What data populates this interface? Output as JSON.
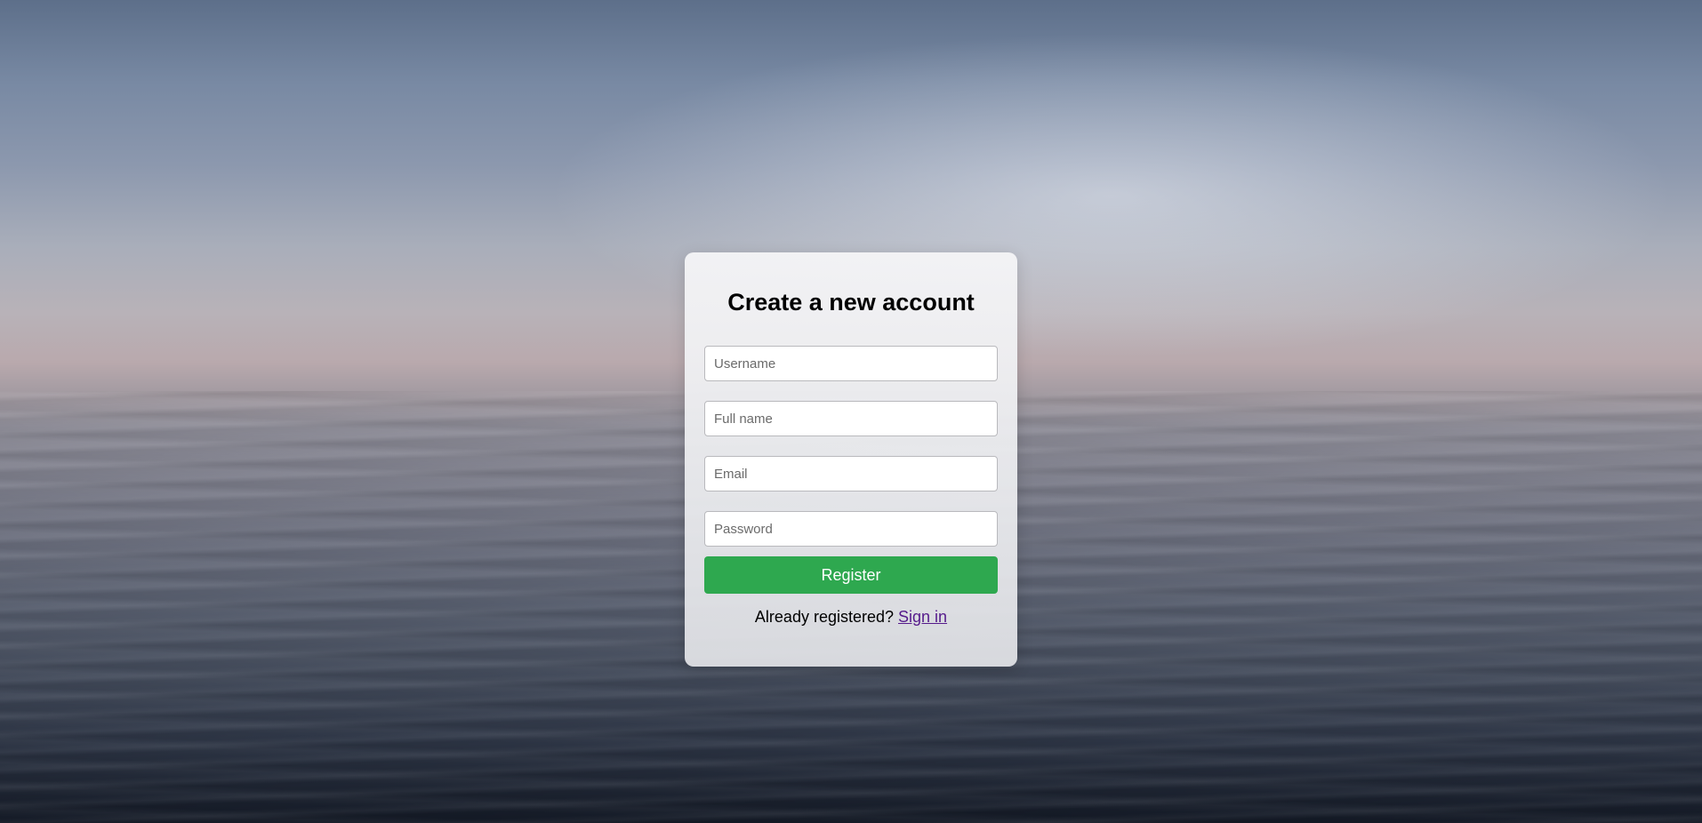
{
  "form": {
    "title": "Create a new account",
    "username_placeholder": "Username",
    "fullname_placeholder": "Full name",
    "email_placeholder": "Email",
    "password_placeholder": "Password",
    "register_label": "Register",
    "already_registered_text": "Already registered?",
    "signin_label": "Sign in"
  },
  "colors": {
    "button": "#2ea84f",
    "link": "#551a8b"
  }
}
